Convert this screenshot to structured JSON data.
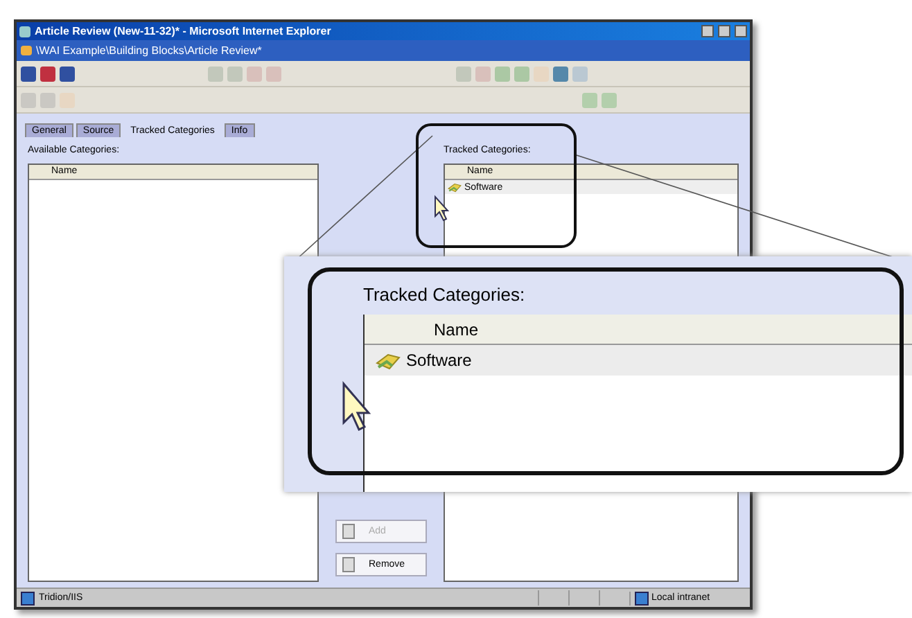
{
  "window": {
    "title": "Article Review (New-11-32)* - Microsoft Internet Explorer"
  },
  "path_bar": {
    "text": "\\WAI Example\\Building Blocks\\Article Review*"
  },
  "tabs": [
    {
      "label": "General",
      "selected": false
    },
    {
      "label": "Source",
      "selected": false
    },
    {
      "label": "Tracked Categories",
      "selected": true
    },
    {
      "label": "Info",
      "selected": false
    }
  ],
  "available": {
    "label": "Available Categories:",
    "column": "Name"
  },
  "actions": [
    {
      "label": "Add",
      "disabled": true
    },
    {
      "label": "Remove",
      "disabled": false
    }
  ],
  "tracked": {
    "label": "Tracked Categories:",
    "column": "Name",
    "rows": [
      {
        "label": "Software"
      }
    ]
  },
  "status_bar": {
    "text": "Tridion/IIS",
    "zone": "Local intranet"
  },
  "callout": {
    "label": "Tracked Categories:",
    "column": "Name",
    "rows": [
      {
        "label": "Software"
      }
    ]
  }
}
